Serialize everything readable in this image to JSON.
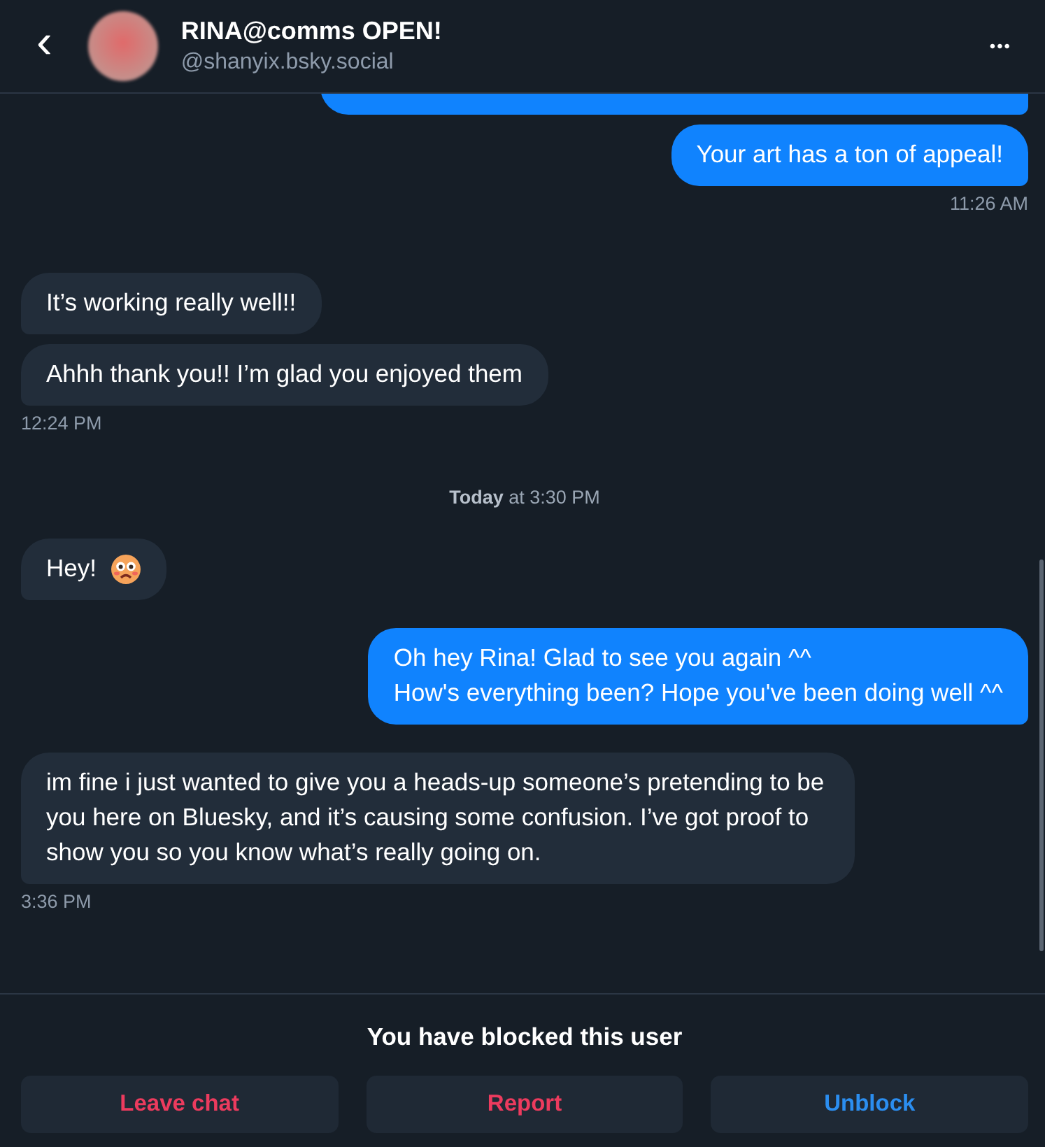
{
  "header": {
    "back": "‹",
    "name": "RINA@comms OPEN!",
    "handle": "@shanyix.bsky.social",
    "menu": "•••"
  },
  "conversation": [
    {
      "kind": "clipped",
      "outgoing": true
    },
    {
      "kind": "message",
      "outgoing": true,
      "text": "Your art has a ton of appeal!"
    },
    {
      "kind": "time",
      "outgoing": true,
      "text": "11:26 AM"
    },
    {
      "kind": "message",
      "outgoing": false,
      "text": "It’s working really well!!"
    },
    {
      "kind": "message",
      "outgoing": false,
      "text": "Ahhh thank you!! I’m glad you enjoyed them"
    },
    {
      "kind": "time",
      "outgoing": false,
      "text": "12:24 PM"
    },
    {
      "kind": "separator",
      "text": "**Today** at 3:30 PM"
    },
    {
      "kind": "emoji_message",
      "outgoing": false,
      "text": "Hey!"
    },
    {
      "kind": "message",
      "outgoing": true,
      "text": "Oh hey Rina! Glad to see you again ^^\nHow's everything been? Hope you've been doing well ^^"
    },
    {
      "kind": "message",
      "outgoing": false,
      "text": "im fine i just wanted to give you a heads-up someone’s pretending to be you here on Bluesky, and it’s causing some confusion. I’ve got proof to show you so you know what’s really going on."
    },
    {
      "kind": "time",
      "outgoing": false,
      "text": "3:36 PM"
    }
  ],
  "footer": {
    "notice": "You have blocked this user",
    "buttons": [
      {
        "label": "Leave chat",
        "danger": true
      },
      {
        "label": "Report",
        "danger": true
      },
      {
        "label": "Unblock",
        "danger": false
      }
    ]
  }
}
